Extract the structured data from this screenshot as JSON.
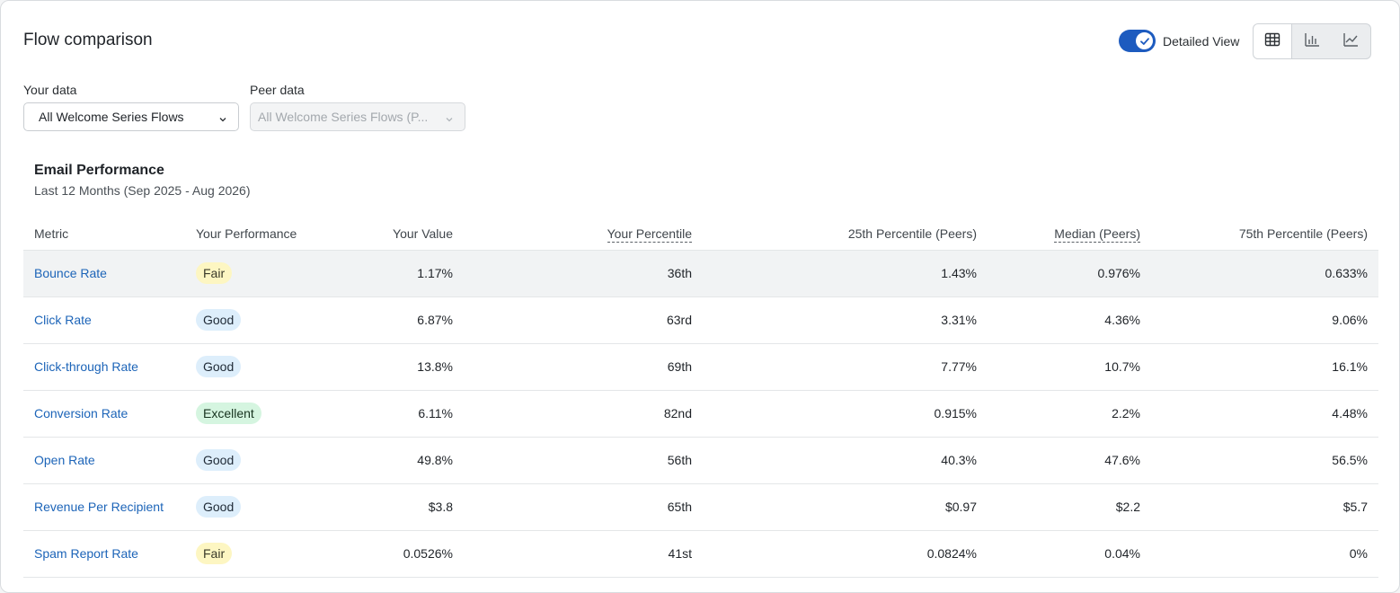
{
  "header": {
    "title": "Flow comparison",
    "toggle_label": "Detailed View",
    "toggle_on": true,
    "views": [
      {
        "icon": "table-icon",
        "active": true
      },
      {
        "icon": "bar-chart-icon",
        "active": false
      },
      {
        "icon": "line-chart-icon",
        "active": false
      }
    ]
  },
  "filters": {
    "your_data_label": "Your data",
    "your_data_value": "All Welcome Series Flows",
    "peer_data_label": "Peer data",
    "peer_data_value": "All Welcome Series Flows (P..."
  },
  "section": {
    "title": "Email Performance",
    "subtitle": "Last 12 Months (Sep 2025 - Aug 2026)"
  },
  "table": {
    "columns": [
      "Metric",
      "Your Performance",
      "Your Value",
      "Your Percentile",
      "25th Percentile (Peers)",
      "Median (Peers)",
      "75th Percentile (Peers)"
    ],
    "rows": [
      {
        "metric": "Bounce Rate",
        "performance": "Fair",
        "level": "fair",
        "value": "1.17%",
        "percentile": "36th",
        "p25": "1.43%",
        "median": "0.976%",
        "p75": "0.633%"
      },
      {
        "metric": "Click Rate",
        "performance": "Good",
        "level": "good",
        "value": "6.87%",
        "percentile": "63rd",
        "p25": "3.31%",
        "median": "4.36%",
        "p75": "9.06%"
      },
      {
        "metric": "Click-through Rate",
        "performance": "Good",
        "level": "good",
        "value": "13.8%",
        "percentile": "69th",
        "p25": "7.77%",
        "median": "10.7%",
        "p75": "16.1%"
      },
      {
        "metric": "Conversion Rate",
        "performance": "Excellent",
        "level": "excellent",
        "value": "6.11%",
        "percentile": "82nd",
        "p25": "0.915%",
        "median": "2.2%",
        "p75": "4.48%"
      },
      {
        "metric": "Open Rate",
        "performance": "Good",
        "level": "good",
        "value": "49.8%",
        "percentile": "56th",
        "p25": "40.3%",
        "median": "47.6%",
        "p75": "56.5%"
      },
      {
        "metric": "Revenue Per Recipient",
        "performance": "Good",
        "level": "good",
        "value": "$3.8",
        "percentile": "65th",
        "p25": "$0.97",
        "median": "$2.2",
        "p75": "$5.7"
      },
      {
        "metric": "Spam Report Rate",
        "performance": "Fair",
        "level": "fair",
        "value": "0.0526%",
        "percentile": "41st",
        "p25": "0.0824%",
        "median": "0.04%",
        "p75": "0%"
      }
    ]
  },
  "colors": {
    "accent": "#1d5bbf",
    "link": "#1c64b8",
    "fair": "#fdf6c2",
    "good": "#ddeefb",
    "excellent": "#d5f5e0"
  }
}
